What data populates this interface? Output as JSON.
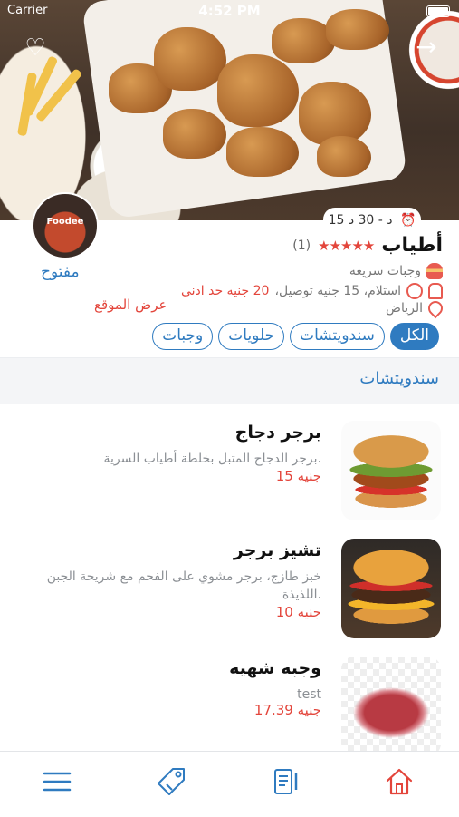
{
  "status_bar": {
    "carrier": "Carrier",
    "time": "4:52 PM"
  },
  "restaurant": {
    "name": "أطياب",
    "stars": "★★★★★",
    "rating_count": "(1)",
    "category": "وجبات سريعه",
    "delivery_prefix": "استلام، 15 جنيه توصيل، ",
    "min_order": "20 جنيه حد ادنى",
    "city": "الرياض",
    "open_status": "مفتوح",
    "map_link": "عرض الموقع",
    "delivery_time": "15 د - 30 د",
    "logo_text": "Foodee"
  },
  "categories": [
    {
      "label": "الكل",
      "active": true
    },
    {
      "label": "سندويتشات",
      "active": false
    },
    {
      "label": "حلويات",
      "active": false
    },
    {
      "label": "وجبات",
      "active": false
    }
  ],
  "section_title": "سندويتشات",
  "items": [
    {
      "title": "برجر دجاج",
      "desc": "برجر الدجاج المتبل بخلطة أطياب السرية.",
      "price": "15 جنيه"
    },
    {
      "title": "تشيز برجر",
      "desc": "خبز طازج، برجر مشوي على الفحم مع شريحة الجبن اللذيذة.",
      "price": "10 جنيه"
    },
    {
      "title": "وجبه شهيه",
      "desc": "test",
      "price": "17.39 جنيه"
    }
  ],
  "tabbar": {
    "icons": [
      "menu-icon",
      "tag-icon",
      "orders-icon",
      "home-icon"
    ],
    "color": "#2f7bc0",
    "active_color": "#e3453b"
  }
}
